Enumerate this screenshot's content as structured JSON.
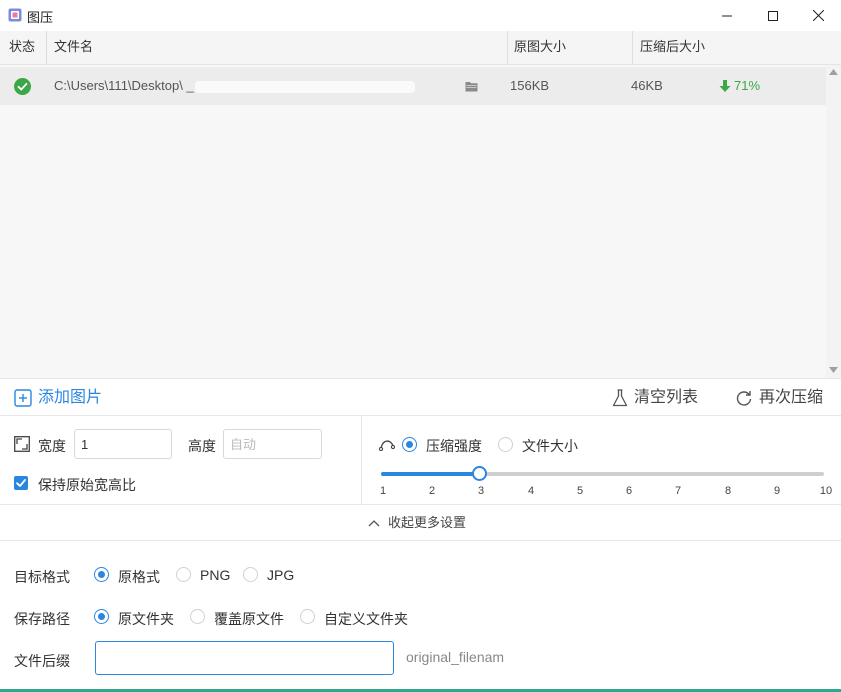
{
  "window": {
    "title": "图压",
    "minimize_icon": "minimize-icon",
    "maximize_icon": "maximize-icon",
    "close_icon": "close-icon"
  },
  "table": {
    "columns": [
      "状态",
      "文件名",
      "原图大小",
      "压缩后大小"
    ],
    "rows": [
      {
        "status_icon": "check-circle-icon",
        "filename": "C:\\Users\\111\\Desktop\\ _",
        "original_size": "156KB",
        "compressed_size": "46KB",
        "reduction": "71%"
      }
    ]
  },
  "toolbar": {
    "add_label": "添加图片",
    "clear_label": "清空列表",
    "recompress_label": "再次压缩"
  },
  "dimensions": {
    "width_label": "宽度",
    "width_value": "1",
    "height_label": "高度",
    "height_placeholder": "自动",
    "keep_ratio_label": "保持原始宽高比",
    "keep_ratio_checked": true
  },
  "compression": {
    "mode_strength_label": "压缩强度",
    "mode_size_label": "文件大小",
    "selected_mode": "压缩强度",
    "level": 3,
    "level_min": 1,
    "level_max": 10,
    "ticks": [
      "1",
      "2",
      "3",
      "4",
      "5",
      "6",
      "7",
      "8",
      "9",
      "10"
    ]
  },
  "collapse": {
    "label": "收起更多设置"
  },
  "output": {
    "format_label": "目标格式",
    "format_options": [
      "原格式",
      "PNG",
      "JPG"
    ],
    "format_selected": "原格式",
    "path_label": "保存路径",
    "path_options": [
      "原文件夹",
      "覆盖原文件",
      "自定义文件夹"
    ],
    "path_selected": "原文件夹",
    "suffix_label": "文件后缀",
    "suffix_value": "",
    "suffix_hint": "original_filenam"
  },
  "colors": {
    "accent": "#2b86e0",
    "success": "#3aa846"
  }
}
